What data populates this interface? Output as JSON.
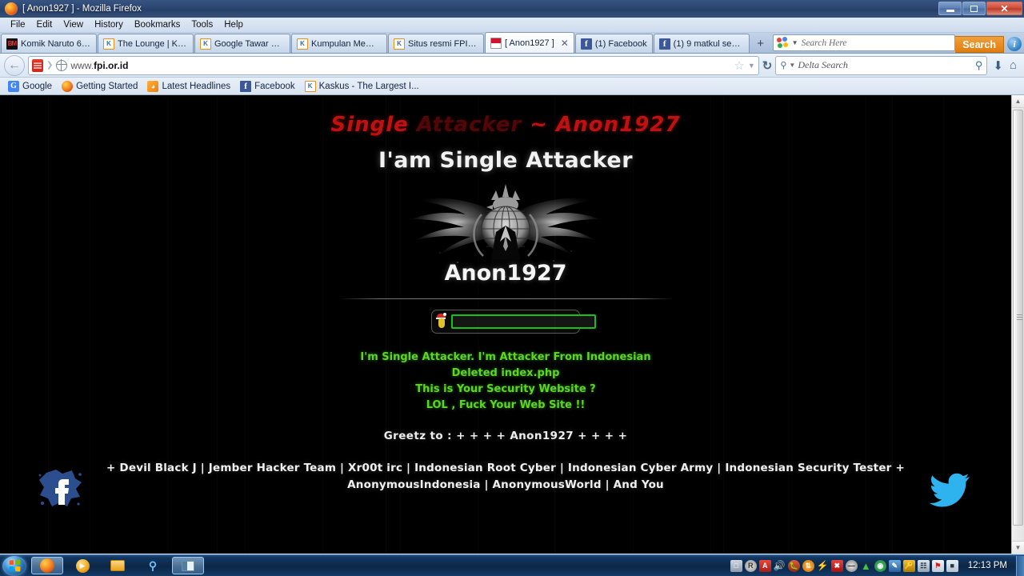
{
  "window": {
    "title": "[ Anon1927 ] - Mozilla Firefox",
    "controls": {
      "minimize": "minimize-button",
      "maximize": "restore-button",
      "close": "✕"
    }
  },
  "menubar": {
    "items": [
      {
        "label": "File"
      },
      {
        "label": "Edit"
      },
      {
        "label": "View"
      },
      {
        "label": "History"
      },
      {
        "label": "Bookmarks"
      },
      {
        "label": "Tools"
      },
      {
        "label": "Help"
      }
    ]
  },
  "tabs": [
    {
      "label": "Komik Naruto 640...",
      "favicon": "bookmark-manga-icon",
      "active": false
    },
    {
      "label": "The Lounge | Kask...",
      "favicon": "kaskus-icon",
      "active": false
    },
    {
      "label": "Google Tawar Kas...",
      "favicon": "kaskus-icon",
      "active": false
    },
    {
      "label": "Kumpulan Meme ...",
      "favicon": "kaskus-icon",
      "active": false
    },
    {
      "label": "Situs resmi FPI (Fr...",
      "favicon": "kaskus-icon",
      "active": false
    },
    {
      "label": "[ Anon1927 ]",
      "favicon": "indonesia-flag-icon",
      "active": true,
      "close": "✕"
    },
    {
      "label": "(1) Facebook",
      "favicon": "facebook-icon",
      "active": false
    },
    {
      "label": "(1) 9 matkul senin...",
      "favicon": "facebook-icon",
      "active": false
    }
  ],
  "newtab_label": "+",
  "tabbar_search": {
    "placeholder": "Search Here",
    "value": "",
    "button_label": "Search"
  },
  "navbar": {
    "back_glyph": "←",
    "url": "www.fpi.or.id",
    "url_prefix": "www.",
    "url_domain": "fpi.or.id",
    "star_glyph": "☆",
    "caret_glyph": "▼",
    "reload_glyph": "↻",
    "download_glyph": "⬇",
    "home_glyph": "⌂"
  },
  "search_box": {
    "placeholder": "Delta Search",
    "value": "Delta Search",
    "magnifier": "⚲"
  },
  "bookmarks": [
    {
      "label": "Google",
      "icon": "google-icon"
    },
    {
      "label": "Getting Started",
      "icon": "firefox-icon"
    },
    {
      "label": "Latest Headlines",
      "icon": "rss-icon"
    },
    {
      "label": "Facebook",
      "icon": "facebook-icon"
    },
    {
      "label": "Kaskus - The Largest I...",
      "icon": "kaskus-icon"
    }
  ],
  "page": {
    "red_title_visible": "Single",
    "red_title_faded": "Attacker",
    "red_title_tail": "~ Anon1927",
    "red_title_full": "Single Attacker ~ Anon1927",
    "white_title": "I'am Single Attacker",
    "emblem_name": "anonymous-eagle-emblem",
    "anon_name": "Anon1927",
    "input_value": "",
    "green_lines": [
      "I'm Single Attacker. I'm Attacker From Indonesian",
      "Deleted index.php",
      "This is Your Security Website ?",
      "LOL , Fuck Your Web Site !!"
    ],
    "greetz": "Greetz to : + + + + Anon1927 + + + +",
    "credits_line1": "+ Devil Black J | Jember Hacker Team | Xr00t irc | Indonesian Root Cyber | Indonesian Cyber Army | Indonesian Security Tester +",
    "credits_line2": "AnonymousIndonesia | AnonymousWorld | And You",
    "social": {
      "facebook": "facebook-splatter-icon",
      "twitter": "twitter-bird-icon"
    },
    "colors": {
      "red_title": "#cf1414",
      "green_text": "#5fd426",
      "white_text": "#f2f2f2",
      "input_border": "#17c217",
      "background": "#000000",
      "twitter_blue": "#2fb3ee",
      "facebook_blue": "#2c4d8e"
    }
  },
  "scrollbar": {
    "up": "▲",
    "down": "▼"
  },
  "taskbar": {
    "start": "windows-start-orb",
    "buttons": [
      {
        "name": "firefox",
        "active": true
      },
      {
        "name": "windows-media-player",
        "active": false
      },
      {
        "name": "file-explorer",
        "active": false
      },
      {
        "name": "search",
        "active": false
      },
      {
        "name": "window-app",
        "active": true
      }
    ],
    "tray_icons": [
      "removable-device-icon",
      "registry-icon",
      "adobe-reader-icon",
      "volume-icon",
      "bug-icon",
      "updater-icon",
      "lightning-icon",
      "avira-icon",
      "idm-icon",
      "green-triangle-icon",
      "network-globe-icon",
      "paint-icon",
      "key-alert-icon",
      "network-icon",
      "flag-alert-icon",
      "battery-icon"
    ],
    "clock": "12:13 PM"
  }
}
